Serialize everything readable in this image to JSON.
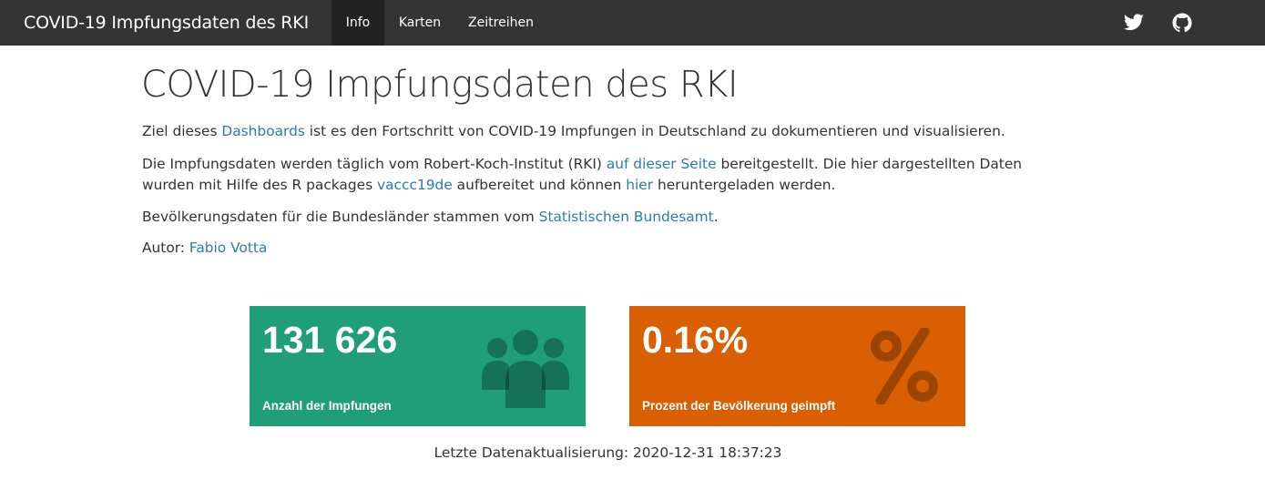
{
  "navbar": {
    "brand": "COVID-19 Impfungsdaten des RKI",
    "tabs": [
      {
        "label": "Info",
        "active": true
      },
      {
        "label": "Karten",
        "active": false
      },
      {
        "label": "Zeitreihen",
        "active": false
      }
    ],
    "icons": [
      "twitter-icon",
      "github-icon"
    ]
  },
  "main": {
    "title": "COVID-19 Impfungsdaten des RKI",
    "p1": {
      "t1": "Ziel dieses ",
      "link": "Dashboards",
      "t2": " ist es den Fortschritt von COVID-19 Impfungen in Deutschland zu dokumentieren und visualisieren."
    },
    "p2": {
      "t1": "Die Impfungsdaten werden täglich vom Robert-Koch-Institut (RKI) ",
      "link1": "auf dieser Seite",
      "t2": " bereitgestellt. Die hier dargestellten Daten wurden mit Hilfe des R packages ",
      "link2": "vaccc19de",
      "t3": " aufbereitet und können ",
      "link3": "hier",
      "t4": " heruntergeladen werden."
    },
    "p3": {
      "t1": "Bevölkerungsdaten für die Bundesländer stammen vom ",
      "link": "Statistischen Bundesamt",
      "t2": "."
    },
    "p4": {
      "t1": "Autor: ",
      "link": "Fabio Votta"
    }
  },
  "valueboxes": [
    {
      "value": "131 626",
      "caption": "Anzahl der Impfungen",
      "icon": "users-icon",
      "color": "#1f9e78"
    },
    {
      "value": "0.16%",
      "caption": "Prozent der Bevölkerung geimpft",
      "icon": "percent-icon",
      "color": "#d95f02"
    }
  ],
  "footer": {
    "updated": "Letzte Datenaktualisierung: 2020-12-31 18:37:23"
  },
  "colors": {
    "navbar": "#343434",
    "link": "#2a7bb0"
  }
}
